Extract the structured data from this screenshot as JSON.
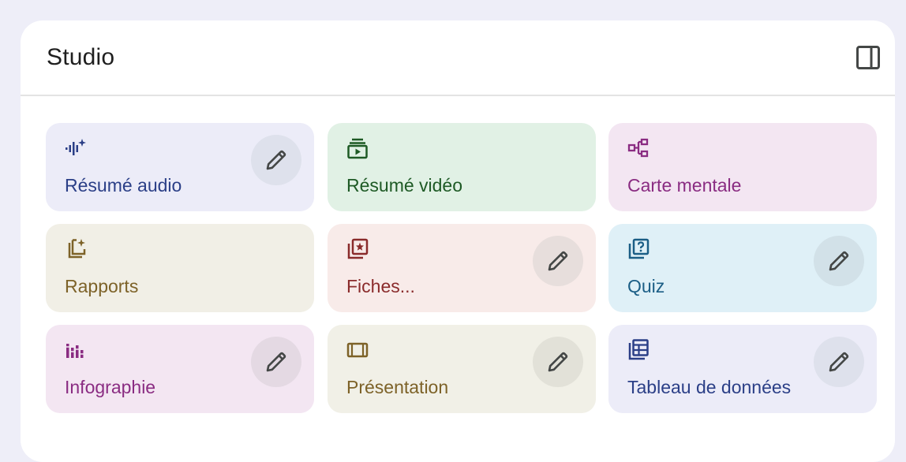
{
  "panel": {
    "title": "Studio",
    "toggle_icon": "side-panel-icon"
  },
  "cards": [
    {
      "label": "Résumé audio",
      "icon": "audio-spark-icon",
      "bg": "#ececf8",
      "color": "#2b3f87",
      "editable": true,
      "edit_bg": "#dee1ec"
    },
    {
      "label": "Résumé vidéo",
      "icon": "video-summary-icon",
      "bg": "#e1f1e5",
      "color": "#1e5a25",
      "editable": false
    },
    {
      "label": "Carte mentale",
      "icon": "mind-map-icon",
      "bg": "#f3e6f2",
      "color": "#8a2c82",
      "editable": false
    },
    {
      "label": "Rapports",
      "icon": "reports-spark-icon",
      "bg": "#f1efe6",
      "color": "#7d6228",
      "editable": false
    },
    {
      "label": "Fiches...",
      "icon": "flashcards-icon",
      "bg": "#f8ebe9",
      "color": "#8a2b2b",
      "editable": true,
      "edit_bg": "#e7dedc"
    },
    {
      "label": "Quiz",
      "icon": "quiz-icon",
      "bg": "#dff0f7",
      "color": "#1b5e86",
      "editable": true,
      "edit_bg": "#d2e1e8"
    },
    {
      "label": "Infographie",
      "icon": "infographic-icon",
      "bg": "#f3e6f2",
      "color": "#8a2c82",
      "editable": true,
      "edit_bg": "#e4d9e3"
    },
    {
      "label": "Présentation",
      "icon": "presentation-icon",
      "bg": "#f1f0e7",
      "color": "#7d6228",
      "editable": true,
      "edit_bg": "#e2e1d8"
    },
    {
      "label": "Tableau de données",
      "icon": "data-table-icon",
      "bg": "#ececf8",
      "color": "#2b3f87",
      "editable": true,
      "edit_bg": "#dee1ec"
    }
  ],
  "edit_icon": "pencil-icon",
  "edit_icon_color": "#444746"
}
